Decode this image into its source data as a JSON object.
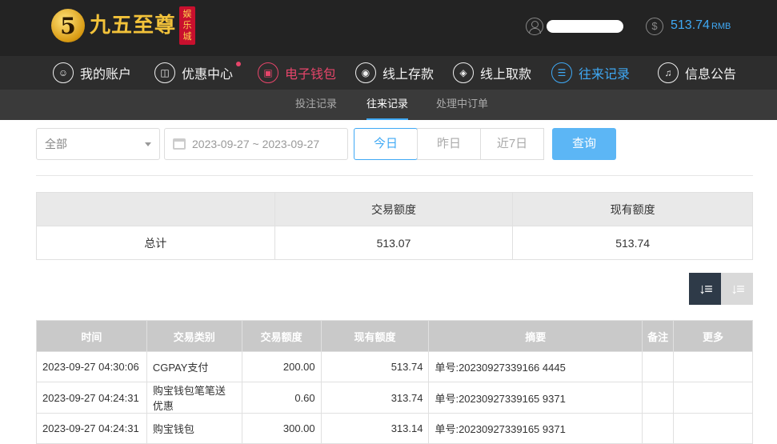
{
  "header": {
    "logo_char": "5",
    "logo_text": "九五至尊",
    "logo_seal": "娱乐城",
    "balance": "513.74",
    "currency": "RMB"
  },
  "nav": [
    {
      "label": "我的账户",
      "icon": "user-icon"
    },
    {
      "label": "优惠中心",
      "icon": "gift-icon"
    },
    {
      "label": "电子钱包",
      "icon": "wallet-icon"
    },
    {
      "label": "线上存款",
      "icon": "deposit-icon"
    },
    {
      "label": "线上取款",
      "icon": "withdraw-icon"
    },
    {
      "label": "往来记录",
      "icon": "records-icon"
    },
    {
      "label": "信息公告",
      "icon": "bell-icon"
    }
  ],
  "subtabs": [
    "投注记录",
    "往来记录",
    "处理中订单"
  ],
  "filters": {
    "type_select": "全部",
    "date_range": "2023-09-27 ~ 2023-09-27",
    "quick": [
      "今日",
      "昨日",
      "近7日"
    ],
    "query": "查询"
  },
  "summary": {
    "headers": [
      "",
      "交易额度",
      "现有额度"
    ],
    "row": [
      "总计",
      "513.07",
      "513.74"
    ]
  },
  "records": {
    "headers": [
      "时间",
      "交易类别",
      "交易额度",
      "现有额度",
      "摘要",
      "备注",
      "更多"
    ],
    "rows": [
      {
        "time": "2023-09-27 04:30:06",
        "type": "CGPAY支付",
        "amount": "200.00",
        "balance": "513.74",
        "memo": "单号:20230927339166 4445",
        "note": "",
        "more": ""
      },
      {
        "time": "2023-09-27 04:24:31",
        "type": "购宝钱包笔笔送优惠",
        "amount": "0.60",
        "balance": "313.74",
        "memo": "单号:20230927339165 9371",
        "note": "",
        "more": ""
      },
      {
        "time": "2023-09-27 04:24:31",
        "type": "购宝钱包",
        "amount": "300.00",
        "balance": "313.14",
        "memo": "单号:20230927339165 9371",
        "note": "",
        "more": ""
      }
    ]
  }
}
